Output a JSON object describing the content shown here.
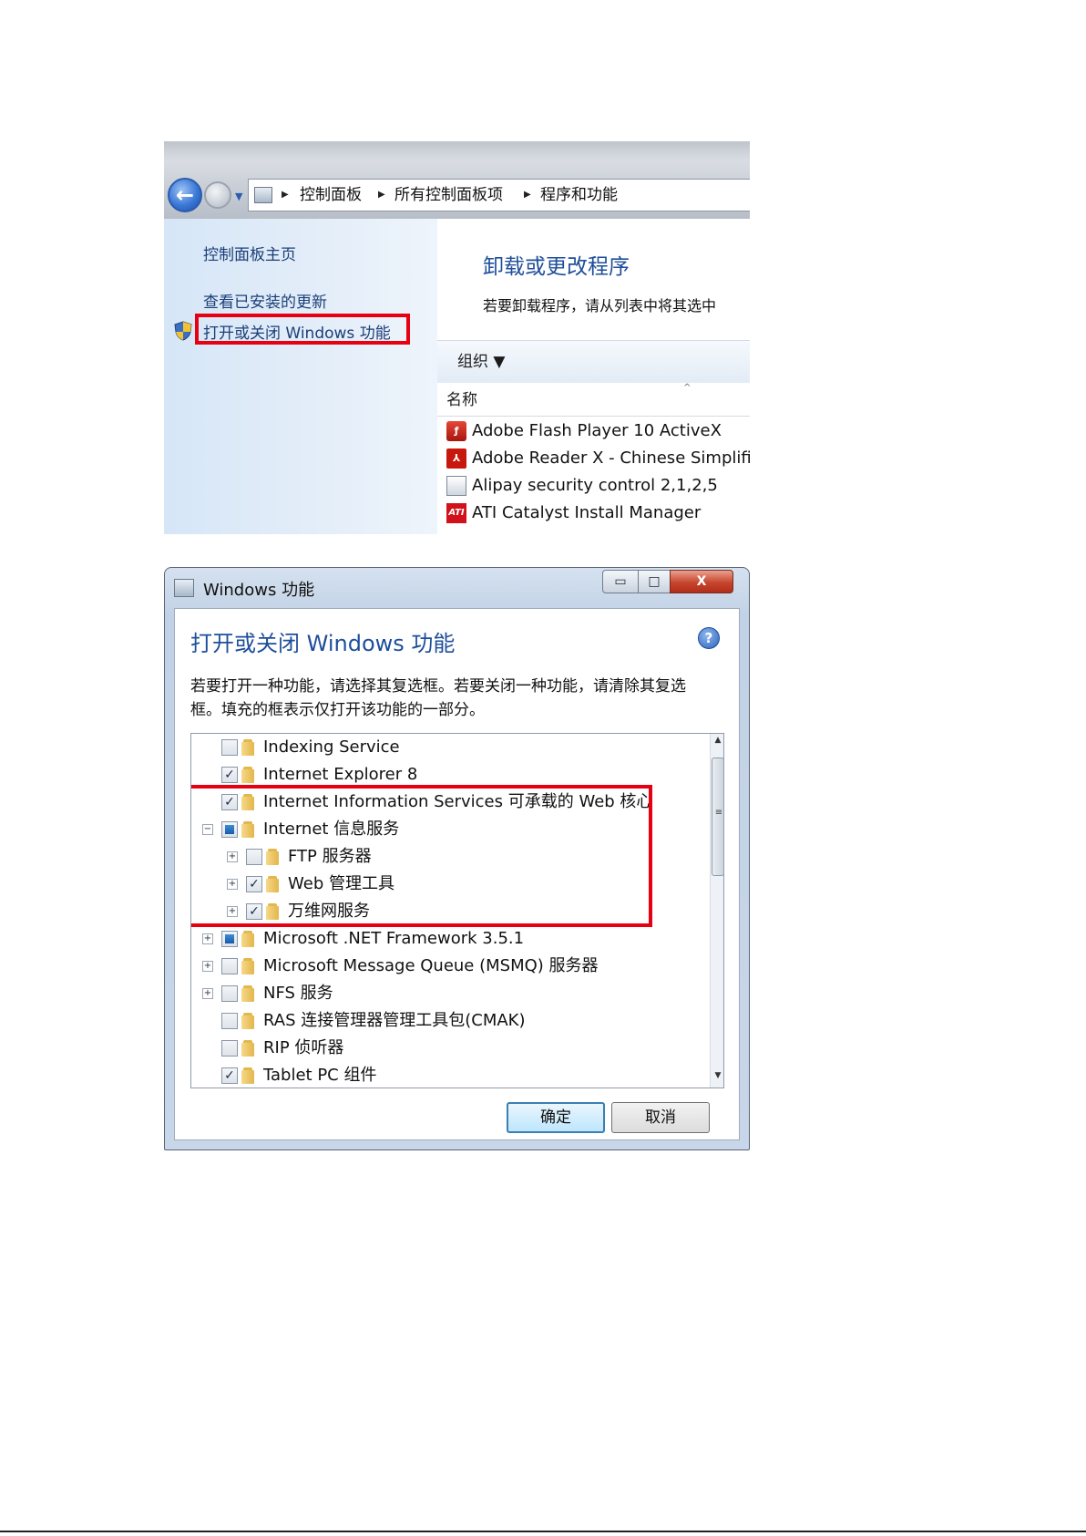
{
  "control_panel": {
    "breadcrumb": [
      "控制面板",
      "所有控制面板项",
      "程序和功能"
    ],
    "sidebar": {
      "home_link": "控制面板主页",
      "updates_link": "查看已安装的更新",
      "features_link": "打开或关闭 Windows 功能"
    },
    "main": {
      "title": "卸载或更改程序",
      "description": "若要卸载程序，请从列表中将其选中",
      "organize_label": "组织 ▼",
      "column_name": "名称",
      "programs": [
        {
          "name": "Adobe Flash Player 10 ActiveX",
          "icon": "flash-icon"
        },
        {
          "name": "Adobe Reader X - Chinese Simplifi",
          "icon": "adobe-reader-icon"
        },
        {
          "name": "Alipay security control 2,1,2,5",
          "icon": "program-icon"
        },
        {
          "name": "ATI Catalyst Install Manager",
          "icon": "ati-icon"
        }
      ]
    }
  },
  "features_dialog": {
    "window_title": "Windows 功能",
    "heading": "打开或关闭 Windows 功能",
    "description_line1": "若要打开一种功能，请选择其复选框。若要关闭一种功能，请清除其复选",
    "description_line2": "框。填充的框表示仅打开该功能的一部分。",
    "features": [
      {
        "label": "Indexing Service",
        "state": "unchecked",
        "expander": "none",
        "level": 0
      },
      {
        "label": "Internet Explorer 8",
        "state": "checked",
        "expander": "none",
        "level": 0
      },
      {
        "label": "Internet Information Services 可承载的 Web 核心",
        "state": "checked",
        "expander": "none",
        "level": 0
      },
      {
        "label": "Internet 信息服务",
        "state": "partial",
        "expander": "collapse",
        "level": 0
      },
      {
        "label": "FTP 服务器",
        "state": "unchecked",
        "expander": "expand",
        "level": 1
      },
      {
        "label": "Web 管理工具",
        "state": "checked",
        "expander": "expand",
        "level": 1
      },
      {
        "label": "万维网服务",
        "state": "checked",
        "expander": "expand",
        "level": 1
      },
      {
        "label": "Microsoft .NET Framework 3.5.1",
        "state": "partial",
        "expander": "expand",
        "level": 0
      },
      {
        "label": "Microsoft Message Queue (MSMQ) 服务器",
        "state": "unchecked",
        "expander": "expand",
        "level": 0
      },
      {
        "label": "NFS 服务",
        "state": "unchecked",
        "expander": "expand",
        "level": 0
      },
      {
        "label": "RAS 连接管理器管理工具包(CMAK)",
        "state": "unchecked",
        "expander": "none",
        "level": 0
      },
      {
        "label": "RIP 侦听器",
        "state": "unchecked",
        "expander": "none",
        "level": 0
      },
      {
        "label": "Tablet PC 组件",
        "state": "checked",
        "expander": "none",
        "level": 0
      }
    ],
    "ok_label": "确定",
    "cancel_label": "取消"
  },
  "colors": {
    "highlight_red": "#e60012",
    "heading_blue": "#1e4e9b",
    "link_blue": "#1b3f78"
  }
}
